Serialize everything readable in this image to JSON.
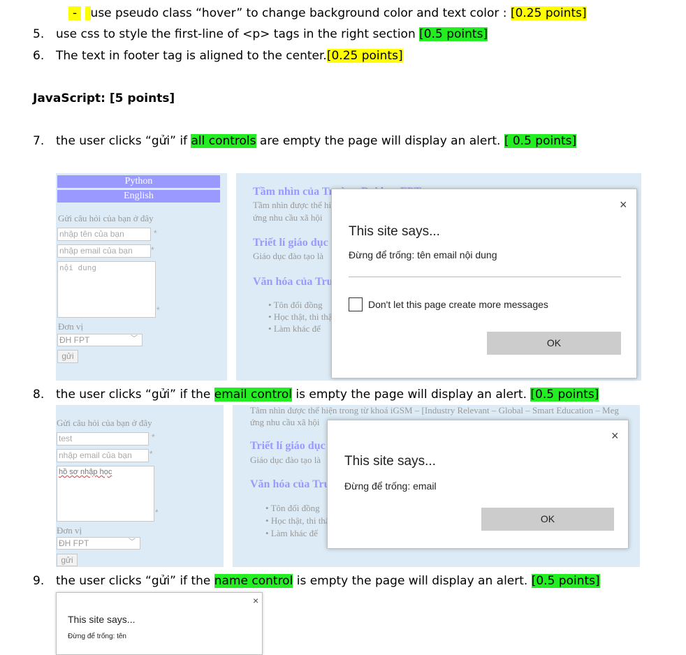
{
  "doc": {
    "line_hover": {
      "dash": "-",
      "text": "use pseudo class “hover” to change background color and text color :",
      "points": "[0.25 points]"
    },
    "item5": {
      "num": "5.",
      "text": "use css to style the first-line of <p> tags in the right section",
      "points": "[0.5 points]"
    },
    "item6": {
      "num": "6.",
      "text": "The text in footer tag is aligned to the center.",
      "points": "[0.25 points]"
    },
    "js_heading": "JavaScript:  [5 points]",
    "item7": {
      "num": "7.",
      "pre": "the user clicks “gửi” if",
      "highlight": "all controls",
      "post": "are empty the page will display an alert.",
      "points": "[ 0.5 points]"
    },
    "item8": {
      "num": "8.",
      "pre": "the user clicks “gửi” if the",
      "highlight": "email control",
      "post": "is empty the page will display an alert.",
      "points": "[0.5 points]"
    },
    "item9": {
      "num": "9.",
      "pre": "the user clicks “gửi” if the",
      "highlight": "name control",
      "post": "is empty the page will display an alert.",
      "points": "[0.5 points]"
    }
  },
  "shot1": {
    "menu": [
      "Python",
      "English"
    ],
    "form_title": "Gửi câu hỏi của bạn ở đây",
    "name_placeholder": "nhập tên của bạn",
    "email_placeholder": "nhập email của bạn",
    "content_placeholder": "nội dung",
    "star": "*",
    "unit_label": "Đơn vị",
    "unit_value": "ĐH FPT",
    "send": "gửi",
    "h1": "Tầm nhìn của Trường Đại học FPT",
    "p1a": "Tầm nhìn được thể hiện",
    "p1b": "ứng nhu cầu xã hội",
    "h2": "Triết lí giáo dục",
    "p2": "Giáo dục đào tạo là",
    "h3": "Văn hóa của Trường",
    "bullets": [
      "Tôn đổi đồng",
      "Học thật, thi thật",
      "Làm khác để"
    ],
    "dialog": {
      "title": "This site says...",
      "message": "Đừng để trống:  tên  email  nội dung",
      "checkbox": "Don't let this page create more messages",
      "ok": "OK",
      "close": "×"
    }
  },
  "shot2": {
    "top_line": "Tâm nhìn được thể hiện trong từ khoá iGSM – [Industry Relevant – Global – Smart Education – Meg",
    "p1b": "ứng nhu cầu xã hội",
    "form_title": "Gửi câu hỏi của bạn ở đây",
    "name_value": "test",
    "email_placeholder": "nhập email của bạn",
    "content_value": "hồ sơ nhập học",
    "star": "*",
    "unit_label": "Đơn vị",
    "unit_value": "ĐH FPT",
    "send": "gửi",
    "h2": "Triết lí giáo dục",
    "p2": "Giáo dục đào tạo là",
    "h3": "Văn hóa của Trường",
    "bullets": [
      "Tôn đổi đồng",
      "Học thật, thi thật",
      "Làm khác để"
    ],
    "dialog": {
      "title": "This site says...",
      "message": "Đừng để trống:  email",
      "ok": "OK",
      "close": "×"
    }
  },
  "shot3": {
    "dialog": {
      "title": "This site says...",
      "message": "Đừng để trống:  tên",
      "close": "×"
    }
  }
}
